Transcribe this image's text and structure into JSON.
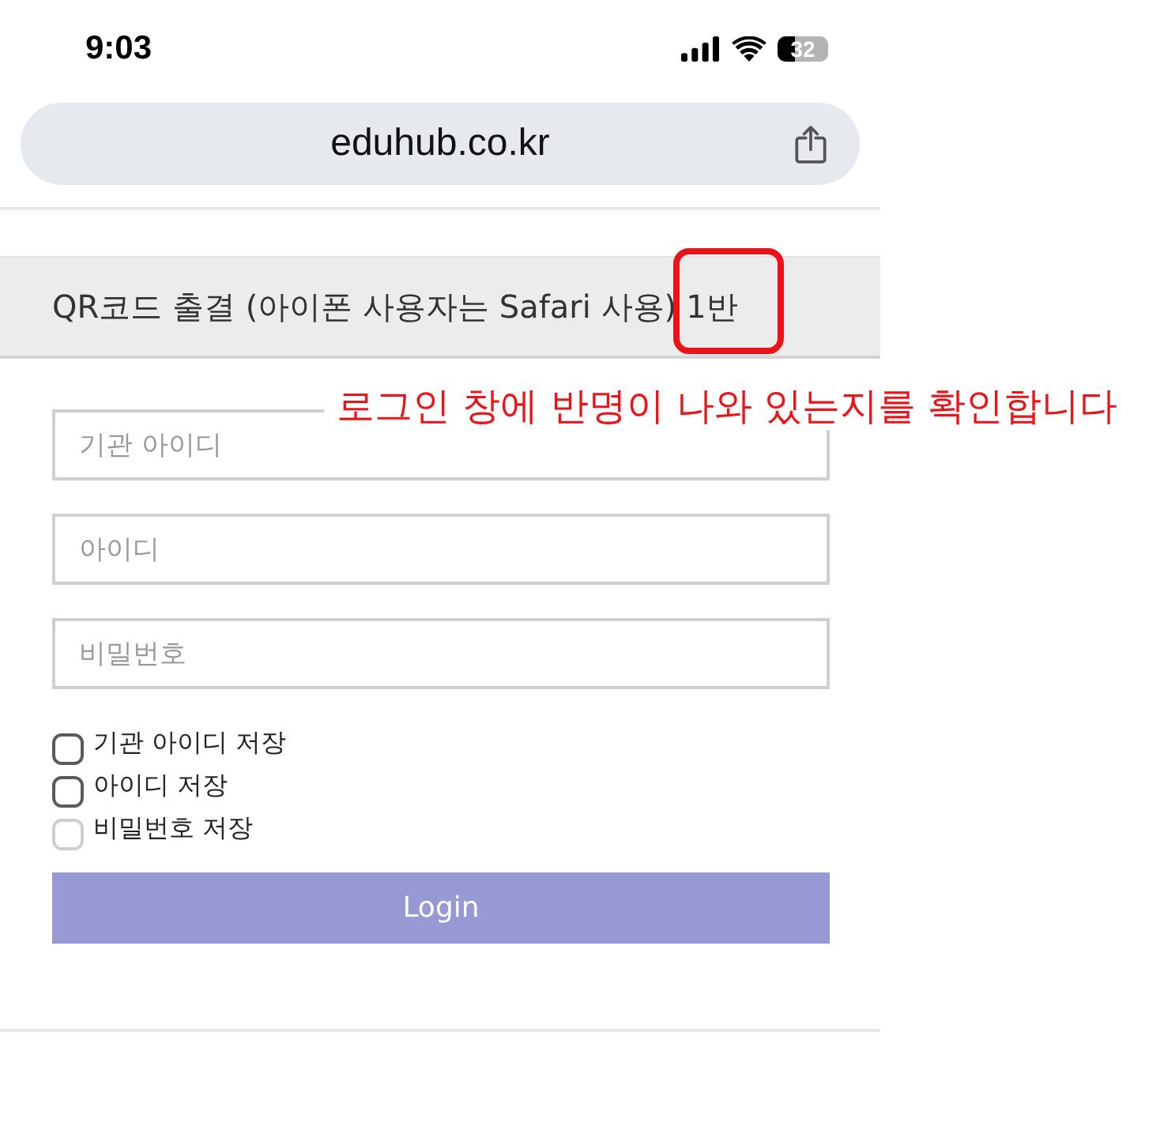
{
  "status_bar": {
    "time": "9:03",
    "battery": "32"
  },
  "address_bar": {
    "url": "eduhub.co.kr"
  },
  "header": {
    "title": "QR코드 출결 (아이폰 사용자는 Safari 사용)",
    "class_label": {
      "text": "1반",
      "highlighted": true
    }
  },
  "annotation": {
    "text": "로그인 창에 반명이 나와 있는지를 확인합니다"
  },
  "fields": [
    {
      "placeholder": "기관 아이디"
    },
    {
      "placeholder": "아이디"
    },
    {
      "placeholder": "비밀번호"
    }
  ],
  "checkboxes": [
    {
      "label": "기관 아이디 저장",
      "checked": false,
      "disabled": false
    },
    {
      "label": "아이디 저장",
      "checked": false,
      "disabled": false
    },
    {
      "label": "비밀번호 저장",
      "checked": false,
      "disabled": true
    }
  ],
  "login_button": {
    "label": "Login"
  }
}
